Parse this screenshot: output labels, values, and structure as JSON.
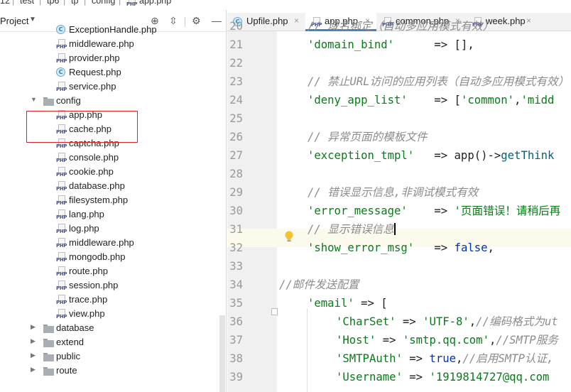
{
  "breadcrumb": [
    {
      "label": "12",
      "kind": "text"
    },
    {
      "label": "test",
      "kind": "folder"
    },
    {
      "label": "tp6",
      "kind": "folder"
    },
    {
      "label": "tp",
      "kind": "folder"
    },
    {
      "label": "config",
      "kind": "folder"
    },
    {
      "label": "app.php",
      "kind": "php"
    }
  ],
  "project": {
    "title": "Project",
    "header_icons": [
      "target-icon",
      "collapse-all-icon",
      "gear-icon",
      "minimize-icon"
    ],
    "tree": [
      {
        "label": "ExceptionHandle.php",
        "icon": "class",
        "indent": 1,
        "arrow": ""
      },
      {
        "label": "middleware.php",
        "icon": "php",
        "indent": 1,
        "arrow": ""
      },
      {
        "label": "provider.php",
        "icon": "php",
        "indent": 1,
        "arrow": ""
      },
      {
        "label": "Request.php",
        "icon": "class",
        "indent": 1,
        "arrow": ""
      },
      {
        "label": "service.php",
        "icon": "php",
        "indent": 1,
        "arrow": ""
      },
      {
        "label": "config",
        "icon": "folder",
        "indent": 0,
        "arrow": "▼"
      },
      {
        "label": "app.php",
        "icon": "php",
        "indent": 1,
        "arrow": ""
      },
      {
        "label": "cache.php",
        "icon": "php",
        "indent": 1,
        "arrow": ""
      },
      {
        "label": "captcha.php",
        "icon": "php",
        "indent": 1,
        "arrow": ""
      },
      {
        "label": "console.php",
        "icon": "php",
        "indent": 1,
        "arrow": ""
      },
      {
        "label": "cookie.php",
        "icon": "php",
        "indent": 1,
        "arrow": ""
      },
      {
        "label": "database.php",
        "icon": "php",
        "indent": 1,
        "arrow": ""
      },
      {
        "label": "filesystem.php",
        "icon": "php",
        "indent": 1,
        "arrow": ""
      },
      {
        "label": "lang.php",
        "icon": "php",
        "indent": 1,
        "arrow": ""
      },
      {
        "label": "log.php",
        "icon": "php",
        "indent": 1,
        "arrow": ""
      },
      {
        "label": "middleware.php",
        "icon": "php",
        "indent": 1,
        "arrow": ""
      },
      {
        "label": "mongodb.php",
        "icon": "php",
        "indent": 1,
        "arrow": ""
      },
      {
        "label": "route.php",
        "icon": "php",
        "indent": 1,
        "arrow": ""
      },
      {
        "label": "session.php",
        "icon": "php",
        "indent": 1,
        "arrow": ""
      },
      {
        "label": "trace.php",
        "icon": "php",
        "indent": 1,
        "arrow": ""
      },
      {
        "label": "view.php",
        "icon": "php",
        "indent": 1,
        "arrow": ""
      },
      {
        "label": "database",
        "icon": "folder",
        "indent": 0,
        "arrow": "▶"
      },
      {
        "label": "extend",
        "icon": "folder",
        "indent": 0,
        "arrow": "▶"
      },
      {
        "label": "public",
        "icon": "folder",
        "indent": 0,
        "arrow": "▶"
      },
      {
        "label": "route",
        "icon": "folder",
        "indent": 0,
        "arrow": "▶"
      }
    ]
  },
  "tabs": [
    {
      "label": "Upfile.php",
      "icon": "class",
      "active": false
    },
    {
      "label": "app.php",
      "icon": "php",
      "active": true
    },
    {
      "label": "common.php",
      "icon": "php",
      "active": false
    },
    {
      "label": "week.php",
      "icon": "php",
      "active": false
    }
  ],
  "editor": {
    "current_line": "31",
    "lines": [
      {
        "n": "20",
        "tokens": [
          {
            "t": "// 域名绑定（自动多应用模式有效）",
            "c": "c"
          }
        ],
        "indent": 1
      },
      {
        "n": "21",
        "tokens": [
          {
            "t": "'domain_bind'",
            "c": "s"
          },
          {
            "t": "      => [],",
            "c": "p"
          }
        ],
        "indent": 1
      },
      {
        "n": "22",
        "tokens": [],
        "indent": 0
      },
      {
        "n": "23",
        "tokens": [
          {
            "t": "// 禁止URL访问的应用列表（自动多应用模式有效）",
            "c": "c"
          }
        ],
        "indent": 1
      },
      {
        "n": "24",
        "tokens": [
          {
            "t": "'deny_app_list'",
            "c": "s"
          },
          {
            "t": "    => [",
            "c": "p"
          },
          {
            "t": "'common'",
            "c": "s"
          },
          {
            "t": ",",
            "c": "p"
          },
          {
            "t": "'midd",
            "c": "s"
          }
        ],
        "indent": 1
      },
      {
        "n": "25",
        "tokens": [],
        "indent": 0
      },
      {
        "n": "26",
        "tokens": [
          {
            "t": "// 异常页面的模板文件",
            "c": "c"
          }
        ],
        "indent": 1
      },
      {
        "n": "27",
        "tokens": [
          {
            "t": "'exception_tmpl'",
            "c": "s"
          },
          {
            "t": "   => app()->",
            "c": "p"
          },
          {
            "t": "getThink",
            "c": "f"
          }
        ],
        "indent": 1
      },
      {
        "n": "28",
        "tokens": [],
        "indent": 0
      },
      {
        "n": "29",
        "tokens": [
          {
            "t": "// 错误显示信息,非调试模式有效",
            "c": "c"
          }
        ],
        "indent": 1
      },
      {
        "n": "30",
        "tokens": [
          {
            "t": "'error_message'",
            "c": "s"
          },
          {
            "t": "    => ",
            "c": "p"
          },
          {
            "t": "'页面错误！请稍后再",
            "c": "s"
          }
        ],
        "indent": 1
      },
      {
        "n": "31",
        "tokens": [
          {
            "t": "// 显示错误信息",
            "c": "c"
          }
        ],
        "indent": 1,
        "caret": true
      },
      {
        "n": "32",
        "tokens": [
          {
            "t": "'show_error_msg'",
            "c": "s"
          },
          {
            "t": "   => ",
            "c": "p"
          },
          {
            "t": "false",
            "c": "k"
          },
          {
            "t": ",",
            "c": "p"
          }
        ],
        "indent": 1
      },
      {
        "n": "33",
        "tokens": [],
        "indent": 0
      },
      {
        "n": "34",
        "tokens": [
          {
            "t": "//邮件发送配置",
            "c": "c"
          }
        ],
        "indent": 0
      },
      {
        "n": "35",
        "tokens": [
          {
            "t": "'email'",
            "c": "s"
          },
          {
            "t": " => [",
            "c": "p"
          }
        ],
        "indent": 1
      },
      {
        "n": "36",
        "tokens": [
          {
            "t": "'CharSet'",
            "c": "s"
          },
          {
            "t": " => ",
            "c": "p"
          },
          {
            "t": "'UTF-8'",
            "c": "s"
          },
          {
            "t": ",",
            "c": "p"
          },
          {
            "t": "//编码格式为ut",
            "c": "c"
          }
        ],
        "indent": 2
      },
      {
        "n": "37",
        "tokens": [
          {
            "t": "'Host'",
            "c": "s"
          },
          {
            "t": " => ",
            "c": "p"
          },
          {
            "t": "'smtp.qq.com'",
            "c": "s"
          },
          {
            "t": ",",
            "c": "p"
          },
          {
            "t": "//SMTP服务",
            "c": "c"
          }
        ],
        "indent": 2
      },
      {
        "n": "38",
        "tokens": [
          {
            "t": "'SMTPAuth'",
            "c": "s"
          },
          {
            "t": " => ",
            "c": "p"
          },
          {
            "t": "true",
            "c": "k"
          },
          {
            "t": ",",
            "c": "p"
          },
          {
            "t": "//启用SMTP认证,",
            "c": "c"
          }
        ],
        "indent": 2
      },
      {
        "n": "39",
        "tokens": [
          {
            "t": "'Username'",
            "c": "s"
          },
          {
            "t": " => ",
            "c": "p"
          },
          {
            "t": "'1919814727@qq.com",
            "c": "s"
          }
        ],
        "indent": 2
      }
    ]
  },
  "colors": {
    "string": "#067d17",
    "comment": "#8c8c8c",
    "keyword": "#0033b3",
    "function": "#00627a",
    "highlight_box": "#d9252a",
    "active_tab_underline": "#4083c9"
  }
}
